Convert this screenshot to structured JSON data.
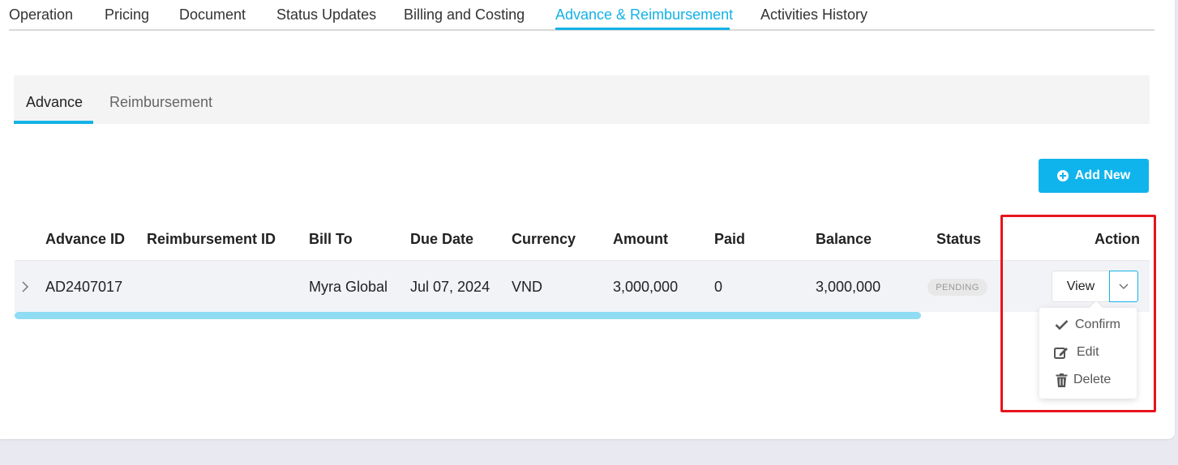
{
  "top_tabs": [
    {
      "label": "Operation"
    },
    {
      "label": "Pricing"
    },
    {
      "label": "Document"
    },
    {
      "label": "Status Updates"
    },
    {
      "label": "Billing and Costing"
    },
    {
      "label": "Advance & Reimbursement"
    },
    {
      "label": "Activities History"
    }
  ],
  "active_top_tab": "Advance & Reimbursement",
  "sub_tabs": [
    {
      "label": "Advance"
    },
    {
      "label": "Reimbursement"
    }
  ],
  "active_sub_tab": "Advance",
  "add_button": {
    "label": "Add New",
    "icon": "plus-circle-icon"
  },
  "table": {
    "columns": [
      "Advance ID",
      "Reimbursement ID",
      "Bill To",
      "Due Date",
      "Currency",
      "Amount",
      "Paid",
      "Balance",
      "Status",
      "Action"
    ],
    "rows": [
      {
        "advance_id": "AD2407017",
        "reimbursement_id": "",
        "bill_to": "Myra Global",
        "due_date": "Jul 07, 2024",
        "currency": "VND",
        "amount": "3,000,000",
        "paid": "0",
        "balance": "3,000,000",
        "status": "PENDING"
      }
    ]
  },
  "row_actions": {
    "view_label": "View",
    "menu": [
      {
        "label": "Confirm",
        "icon": "check-icon"
      },
      {
        "label": "Edit",
        "icon": "edit-icon"
      },
      {
        "label": "Delete",
        "icon": "trash-icon"
      }
    ]
  },
  "colors": {
    "accent": "#14b2e6",
    "button": "#10b4ec",
    "highlight_box": "#e8141b",
    "row_background": "#f2f3f7"
  }
}
